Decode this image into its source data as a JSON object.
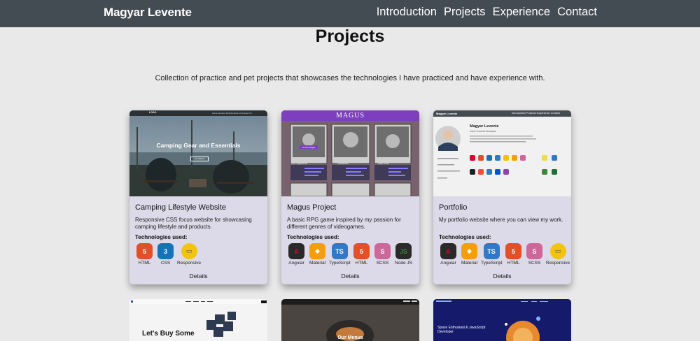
{
  "nav": {
    "brand": "Magyar Levente",
    "links": [
      "Introduction",
      "Projects",
      "Experience",
      "Contact"
    ]
  },
  "page": {
    "title": "Projects",
    "intro": "Collection of practice and pet projects that showcases the technologies I have practiced and have experience with."
  },
  "colors": {
    "navbar": "#434b53",
    "background": "#e9e9ea",
    "card": "#dcd9e8"
  },
  "cards": [
    {
      "title": "Camping Lifestyle Website",
      "description": "Responsive CSS focus website for showcasing camping lifestyle and products.",
      "tech_label": "Technologies used:",
      "thumb": {
        "logo": "LOGO",
        "headline": "Camping Gear and Essentials",
        "menu": "Home  Services  Portfolio  About Us  Contact Us",
        "cta": "Get Started"
      },
      "technologies": [
        {
          "name": "HTML",
          "icon": "html5-icon",
          "color": "#e34f26",
          "glyph": "5"
        },
        {
          "name": "CSS",
          "icon": "css3-icon",
          "color": "#1572b6",
          "glyph": "3"
        },
        {
          "name": "Responsive",
          "icon": "responsive-icon",
          "color": "#f1c40f",
          "glyph": "▭"
        }
      ],
      "details": "Details"
    },
    {
      "title": "Magus Project",
      "description": "A basic RPG game inspired by my passion for different genres of videogames.",
      "tech_label": "Technologies used:",
      "thumb": {
        "banner": "MAGUS",
        "button": "Choose Magus",
        "names": [
          "Kari Nightshade",
          "Stormwind",
          "Ulthi Polar"
        ]
      },
      "technologies": [
        {
          "name": "Angular",
          "icon": "angular-icon",
          "color": "#dd0031",
          "glyph": "A"
        },
        {
          "name": "Material",
          "icon": "material-icon",
          "color": "#f59e0b",
          "glyph": "◆"
        },
        {
          "name": "TypeScript",
          "icon": "typescript-icon",
          "color": "#3178c6",
          "glyph": "TS"
        },
        {
          "name": "HTML",
          "icon": "html5-icon",
          "color": "#e34f26",
          "glyph": "5"
        },
        {
          "name": "SCSS",
          "icon": "scss-icon",
          "color": "#cd6799",
          "glyph": "S"
        },
        {
          "name": "Node JS",
          "icon": "nodejs-icon",
          "color": "#3c873a",
          "glyph": "JS"
        }
      ],
      "details": "Details"
    },
    {
      "title": "Portfolio",
      "description": "My portfolio website where you can view my work.",
      "tech_label": "Technologies used:",
      "thumb": {
        "brand": "Magyar Levente",
        "menu": "Introduction  Projects  Experience  Contact",
        "name": "Magyar Levente",
        "role": "Junior Frontend Developer"
      },
      "technologies": [
        {
          "name": "Angular",
          "icon": "angular-icon",
          "color": "#dd0031",
          "glyph": "A"
        },
        {
          "name": "Material",
          "icon": "material-icon",
          "color": "#f59e0b",
          "glyph": "◆"
        },
        {
          "name": "TypeScript",
          "icon": "typescript-icon",
          "color": "#3178c6",
          "glyph": "TS"
        },
        {
          "name": "HTML",
          "icon": "html5-icon",
          "color": "#e34f26",
          "glyph": "5"
        },
        {
          "name": "SCSS",
          "icon": "scss-icon",
          "color": "#cd6799",
          "glyph": "S"
        },
        {
          "name": "Responsive",
          "icon": "responsive-icon",
          "color": "#f1c40f",
          "glyph": "▭"
        }
      ],
      "details": "Details"
    }
  ],
  "next_row": [
    {
      "headline": "Let's Buy Some"
    },
    {
      "headline": "Our Menus"
    },
    {
      "headline": "Space Enthusiast & JavaScript Developer"
    }
  ]
}
